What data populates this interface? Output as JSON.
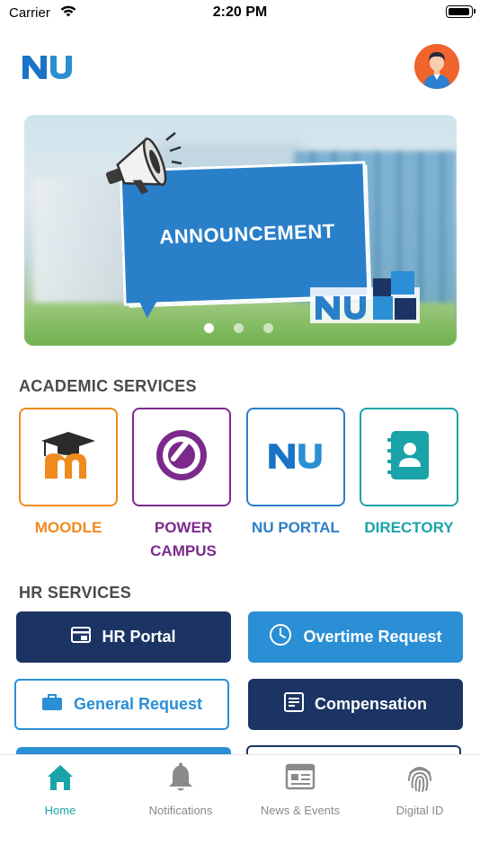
{
  "status_bar": {
    "carrier": "Carrier",
    "time": "2:20 PM"
  },
  "header": {
    "logo": "NU",
    "avatar": "avatar"
  },
  "banner": {
    "text": "ANNOUNCEMENT",
    "dots": 3,
    "active_dot": 1
  },
  "academic": {
    "title": "ACADEMIC SERVICES",
    "items": [
      {
        "label": "MOODLE",
        "color": "#ef8a1e",
        "icon": "moodle-icon"
      },
      {
        "label": "POWER\nCAMPUS",
        "color": "#7b2a8c",
        "icon": "power-campus-icon"
      },
      {
        "label": "NU PORTAL",
        "color": "#2a7fc9",
        "icon": "nu-portal-icon"
      },
      {
        "label": "DIRECTORY",
        "color": "#1aa3a8",
        "icon": "contact-book-icon"
      }
    ]
  },
  "hr": {
    "title": "HR SERVICES",
    "buttons": [
      {
        "label": "HR Portal",
        "icon": "card-icon"
      },
      {
        "label": "Overtime Request",
        "icon": "clock-icon"
      },
      {
        "label": "General Request",
        "icon": "briefcase-icon"
      },
      {
        "label": "Compensation",
        "icon": "document-icon"
      }
    ],
    "colors": {
      "navy": "#1b3464",
      "blue": "#2a8fd4",
      "outline": "#2a8fd4"
    }
  },
  "nav": {
    "items": [
      {
        "label": "Home",
        "icon": "home-icon",
        "active": true
      },
      {
        "label": "Notifications",
        "icon": "bell-icon",
        "active": false
      },
      {
        "label": "News & Events",
        "icon": "newspaper-icon",
        "active": false
      },
      {
        "label": "Digital ID",
        "icon": "fingerprint-icon",
        "active": false
      }
    ],
    "active_color": "#1aa3a8",
    "inactive_color": "#8a8a8a"
  }
}
